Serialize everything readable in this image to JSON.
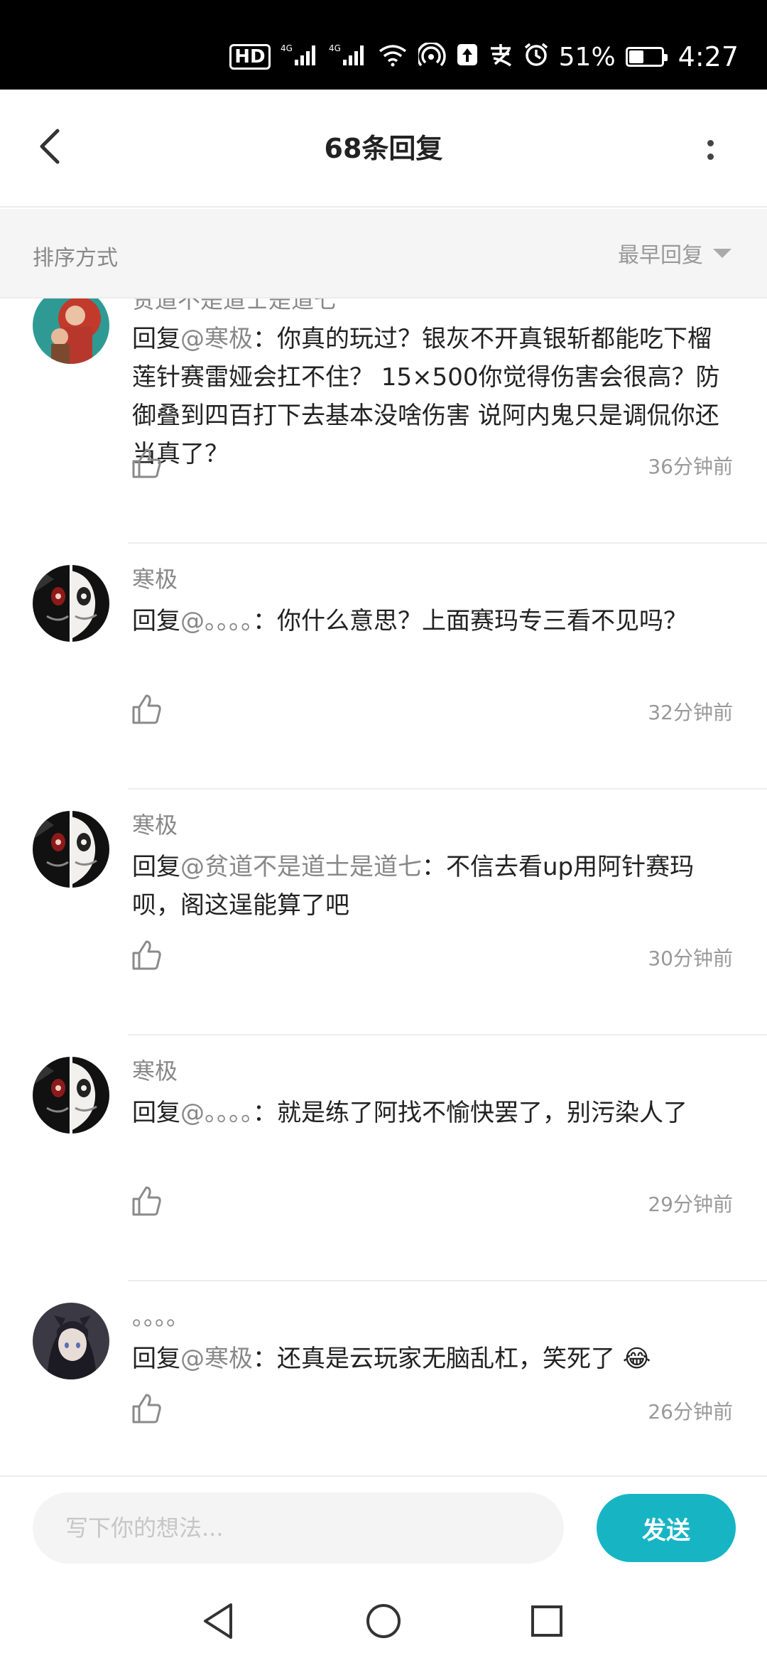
{
  "status_bar": {
    "network_1": "4G",
    "network_2": "4G",
    "battery_percent": "51%",
    "battery_level": 0.51,
    "time": "4:27",
    "icons": [
      "hd-icon",
      "signal-icon",
      "wifi-icon",
      "hotspot-icon",
      "upload-icon",
      "alipay-icon",
      "alarm-icon",
      "battery-icon"
    ]
  },
  "header": {
    "title": "68条回复",
    "back_icon": "chevron-left-icon",
    "more_icon": "more-vertical-icon"
  },
  "sort": {
    "label": "排序方式",
    "selected": "最早回复"
  },
  "comments": [
    {
      "user": "贫道不是道士是道七",
      "reply_prefix": "回复",
      "mention": "@寒极",
      "text": "：你真的玩过？银灰不开真银斩都能吃下榴莲针赛雷娅会扛不住？ 15×500你觉得伤害会很高？防御叠到四百打下去基本没啥伤害 说阿内鬼只是调侃你还当真了？",
      "time": "36分钟前"
    },
    {
      "user": "寒极",
      "reply_prefix": "回复",
      "mention": "@。。。。",
      "text": "：你什么意思？上面赛玛专三看不见吗？",
      "time": "32分钟前"
    },
    {
      "user": "寒极",
      "reply_prefix": "回复",
      "mention": "@贫道不是道士是道七",
      "text": "：不信去看up用阿针赛玛呗，阁这逞能算了吧",
      "time": "30分钟前"
    },
    {
      "user": "寒极",
      "reply_prefix": "回复",
      "mention": "@。。。。",
      "text": "：就是练了阿找不愉快罢了，别污染人了",
      "time": "29分钟前"
    },
    {
      "user": "。。。。",
      "reply_prefix": "回复",
      "mention": "@寒极",
      "text": "：还真是云玩家无脑乱杠，笑死了 😂",
      "time": "26分钟前"
    }
  ],
  "input": {
    "placeholder": "写下你的想法...",
    "value": "",
    "send_label": "发送"
  },
  "colors": {
    "accent": "#17b5c4",
    "status_bar_bg": "#000000",
    "muted_text": "#888888"
  }
}
